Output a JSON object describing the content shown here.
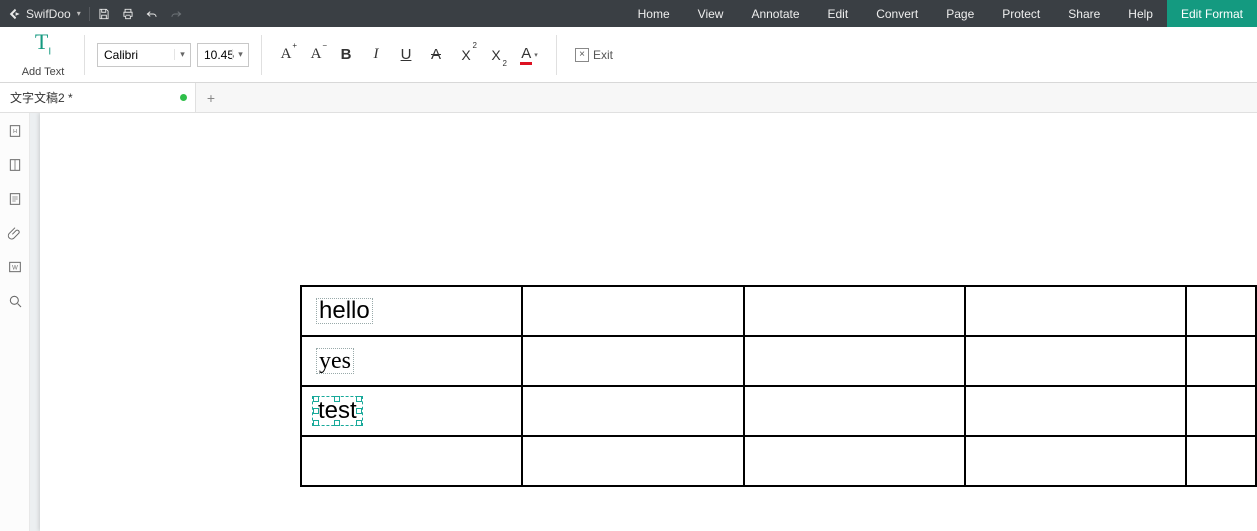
{
  "app": {
    "name": "SwifDoo"
  },
  "menu": {
    "items": [
      "Home",
      "View",
      "Annotate",
      "Edit",
      "Convert",
      "Page",
      "Protect",
      "Share",
      "Help",
      "Edit Format"
    ],
    "active_index": 9
  },
  "ribbon": {
    "add_text_label": "Add Text",
    "font_name": "Calibri",
    "font_size": "10.45",
    "exit_label": "Exit"
  },
  "tabs": {
    "items": [
      {
        "title": "文字文稿2 *",
        "modified": true
      }
    ]
  },
  "document": {
    "table": {
      "rows": 4,
      "cols": 5,
      "cells": {
        "r0c0": "hello",
        "r1c0": "yes",
        "r2c0": "test"
      },
      "active_cell": "r2c0"
    }
  }
}
